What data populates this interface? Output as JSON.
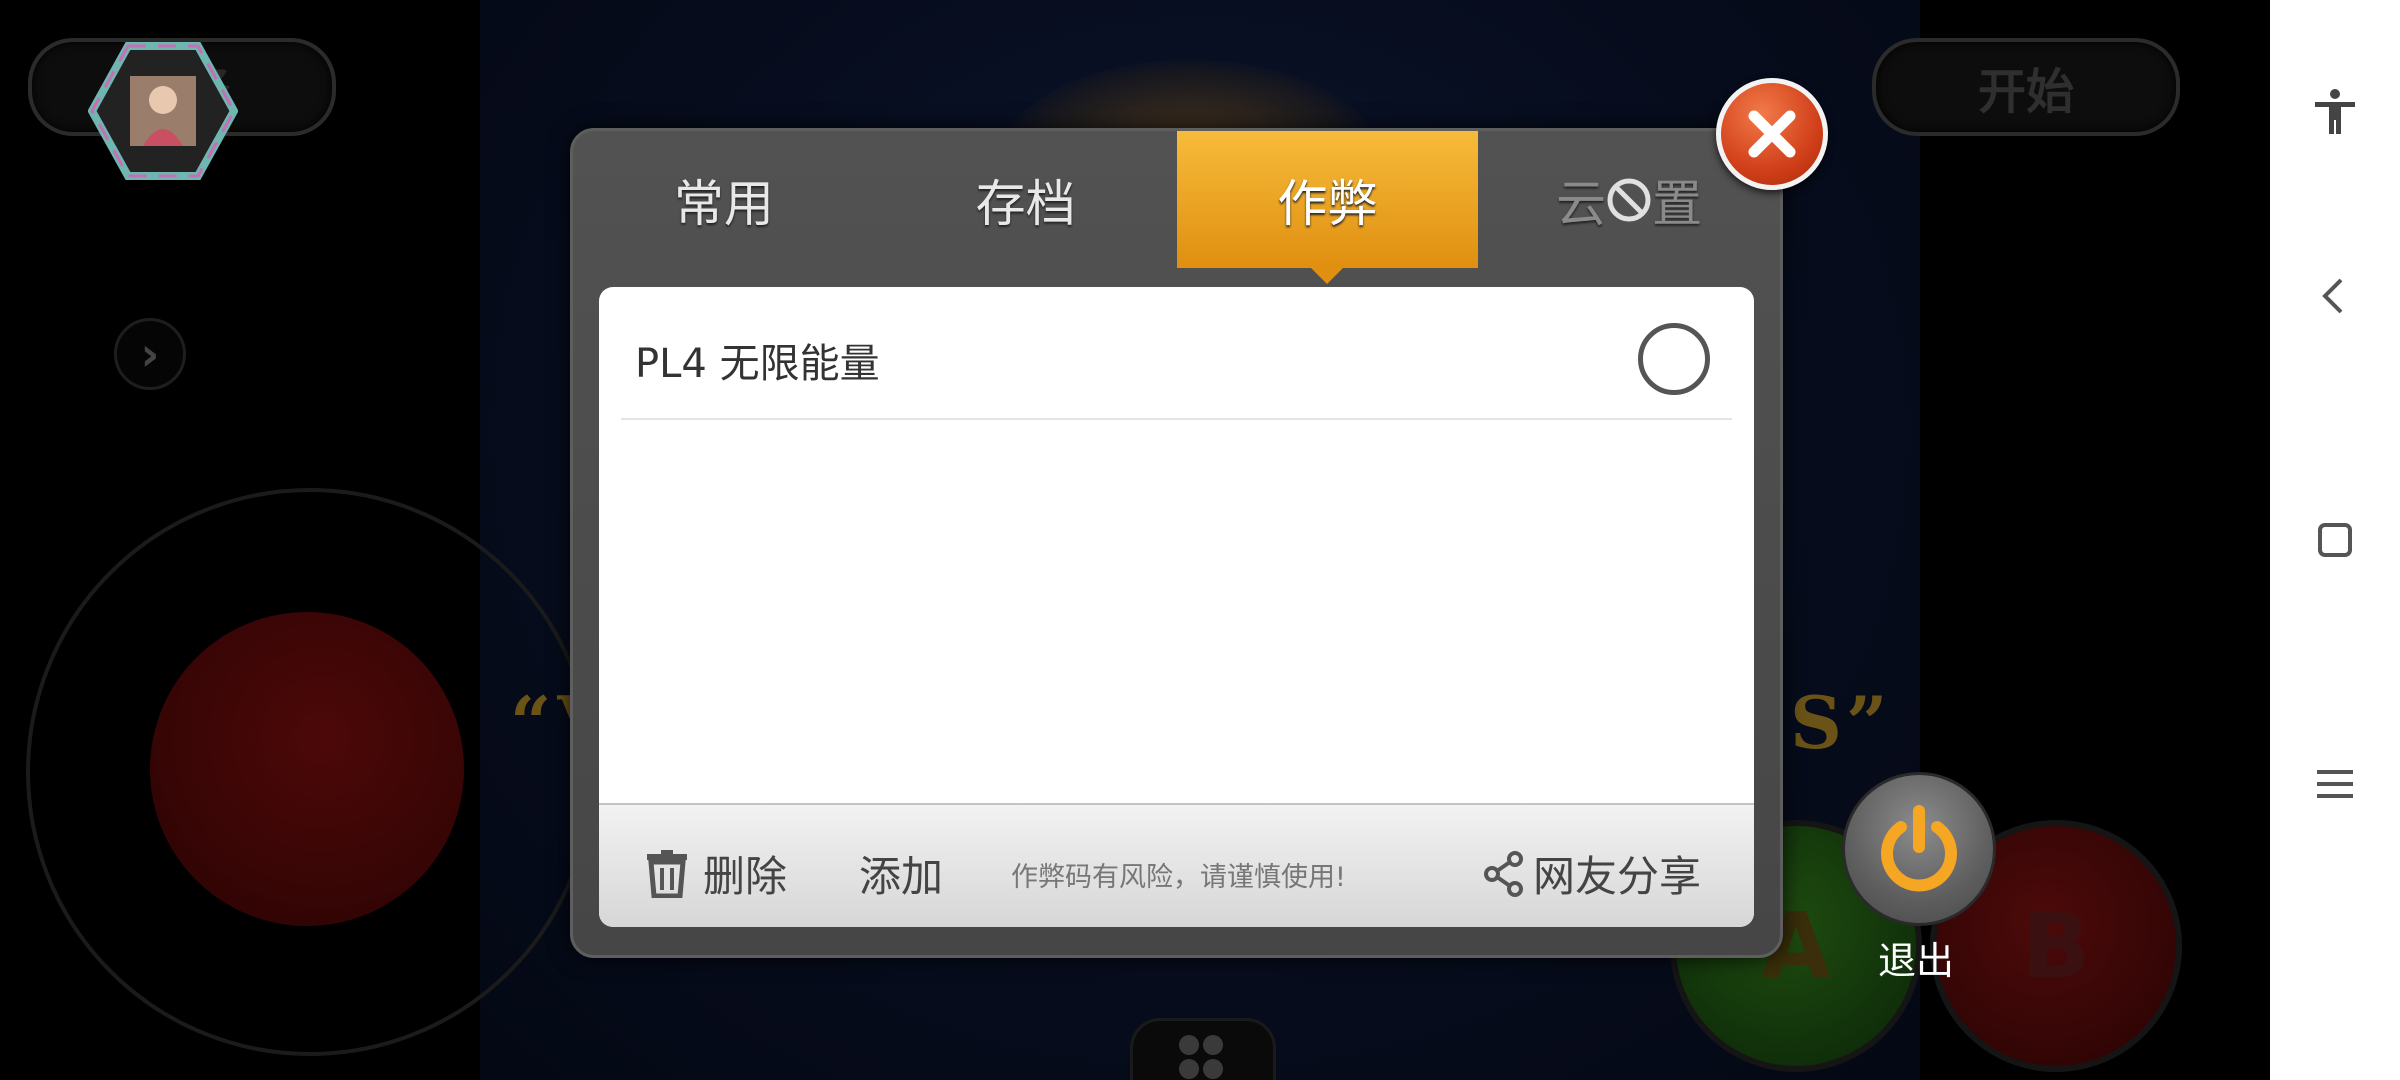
{
  "game": {
    "top_left_button": "选择",
    "top_right_button": "开始",
    "button_a": "A",
    "button_b": "B",
    "banner_text_left": "“V",
    "banner_text_right": "S”"
  },
  "dialog": {
    "tabs": [
      {
        "label": "常用",
        "state": "normal"
      },
      {
        "label": "存档",
        "state": "normal"
      },
      {
        "label": "作弊",
        "state": "active"
      },
      {
        "label_prefix": "云",
        "label_suffix": "置",
        "icon": "no-sign-icon",
        "state": "disabled"
      }
    ],
    "cheats": [
      {
        "label": "PL4 无限能量",
        "enabled": false
      }
    ],
    "toolbar": {
      "delete_label": "删除",
      "add_label": "添加",
      "warning": "作弊码有风险，请谨慎使用!",
      "share_label": "网友分享"
    }
  },
  "exit": {
    "label": "退出"
  },
  "colors": {
    "tab_active": "#f0a020",
    "close_button": "#d1401a",
    "dialog_bg": "#4e4e4e"
  },
  "navbar": {
    "icons": [
      "accessibility-icon",
      "back-icon",
      "home-icon",
      "recents-icon"
    ]
  }
}
